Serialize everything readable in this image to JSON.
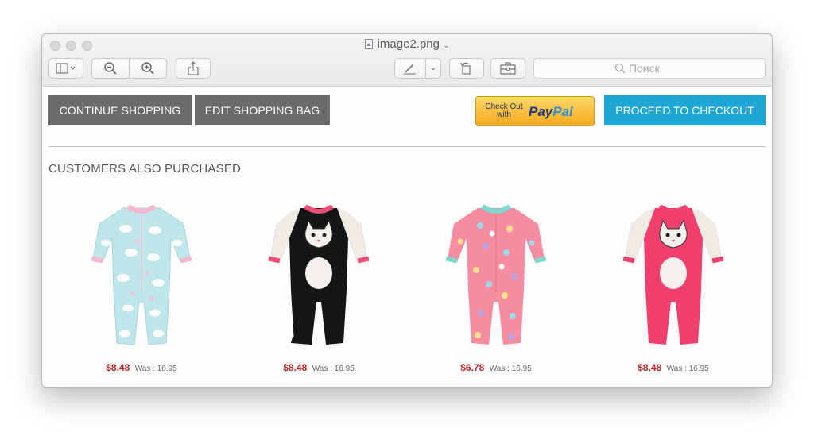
{
  "window": {
    "title": "image2.png",
    "search_placeholder": "Поиск"
  },
  "toolbar": {
    "icons": [
      "sidebar-icon",
      "zoom-out-icon",
      "zoom-in-icon",
      "share-icon",
      "markup-icon",
      "chevron-down-icon",
      "rotate-icon",
      "toolbox-icon",
      "search-icon"
    ]
  },
  "actions": {
    "continue_shopping": "CONTINUE SHOPPING",
    "edit_bag": "EDIT SHOPPING BAG",
    "paypal_check_out": "Check Out",
    "paypal_with": "with",
    "paypal_logo_pay": "Pay",
    "paypal_logo_pal": "Pal",
    "checkout": "PROCEED TO CHECKOUT"
  },
  "section": {
    "title": "CUSTOMERS ALSO PURCHASED"
  },
  "products": [
    {
      "image": "light-blue-cloud-print-footed-pajama",
      "price": "$8.48",
      "was": "Was : 16.95"
    },
    {
      "image": "black-cat-face-footed-pajama",
      "price": "$8.48",
      "was": "Was : 16.95"
    },
    {
      "image": "pink-polka-dot-footed-pajama",
      "price": "$6.78",
      "was": "Was : 16.95"
    },
    {
      "image": "pink-cat-face-footed-pajama",
      "price": "$8.48",
      "was": "Was : 16.95"
    }
  ],
  "colors": {
    "gray_button": "#6b6b6b",
    "checkout_button": "#1ea6d5",
    "price": "#b22929",
    "paypal_gold": "#f4a91a"
  }
}
